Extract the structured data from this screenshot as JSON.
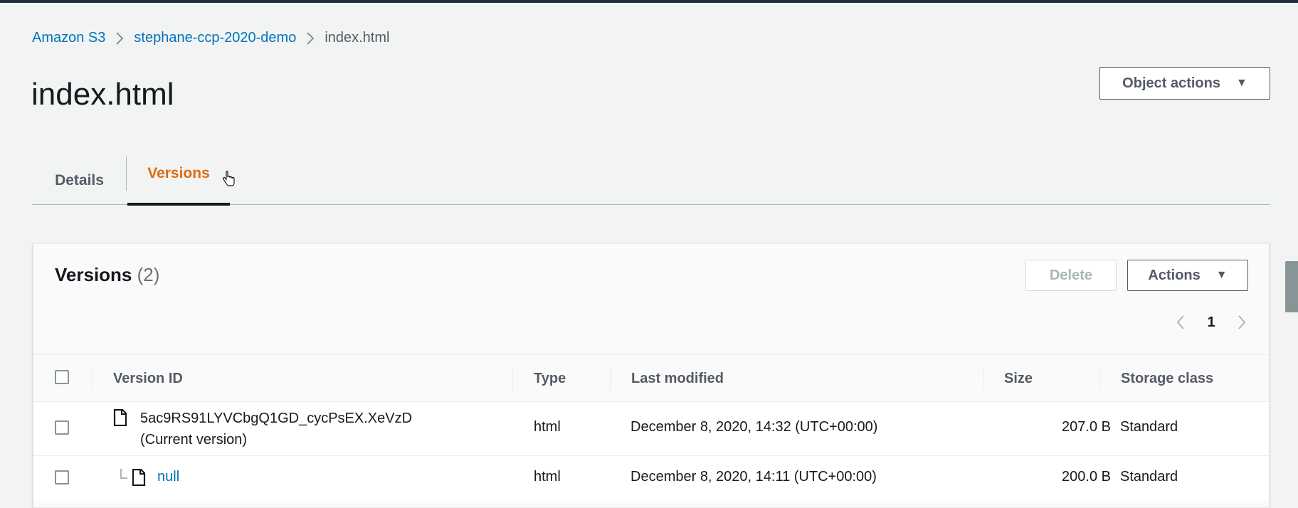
{
  "breadcrumb": {
    "items": [
      "Amazon S3",
      "stephane-ccp-2020-demo"
    ],
    "current": "index.html"
  },
  "page": {
    "title": "index.html",
    "object_actions_label": "Object actions"
  },
  "tabs": [
    {
      "label": "Details",
      "active": false
    },
    {
      "label": "Versions",
      "active": true
    }
  ],
  "versions_panel": {
    "title": "Versions",
    "count": "(2)",
    "delete_label": "Delete",
    "actions_label": "Actions",
    "page_number": "1"
  },
  "table": {
    "columns": [
      "Version ID",
      "Type",
      "Last modified",
      "Size",
      "Storage class"
    ],
    "rows": [
      {
        "version_id": "5ac9RS91LYVCbgQ1GD_cycPsEX.XeVzD",
        "version_note": "(Current version)",
        "type": "html",
        "last_modified": "December 8, 2020, 14:32 (UTC+00:00)",
        "size": "207.0 B",
        "storage_class": "Standard"
      },
      {
        "version_id": "null",
        "type": "html",
        "last_modified": "December 8, 2020, 14:11 (UTC+00:00)",
        "size": "200.0 B",
        "storage_class": "Standard"
      }
    ]
  },
  "colors": {
    "link": "#0073bb",
    "active_tab": "#dd6b10",
    "header_bar": "#232f3e"
  }
}
